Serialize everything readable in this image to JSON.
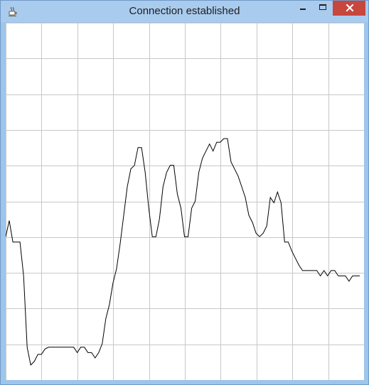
{
  "window": {
    "title": "Connection established",
    "icon": "java-cup-icon",
    "controls": {
      "minimize_icon": "minimize-icon",
      "maximize_icon": "maximize-icon",
      "close_icon": "close-icon"
    },
    "colors": {
      "frame": "#a9cbee",
      "close_button": "#c7463e",
      "plot_background": "#ffffff",
      "grid": "#c8c8c8",
      "line": "#000000"
    }
  },
  "chart_data": {
    "type": "line",
    "title": "",
    "xlabel": "",
    "ylabel": "",
    "grid": true,
    "xlim": [
      0,
      100
    ],
    "ylim": [
      0,
      100
    ],
    "series": [
      {
        "x": [
          0,
          1,
          2,
          3,
          4,
          5,
          6,
          7,
          8,
          9,
          10,
          11,
          12,
          14,
          16,
          18,
          19,
          20,
          21,
          22,
          23,
          24,
          25,
          26,
          27,
          28,
          29,
          30,
          31,
          32,
          33,
          34,
          35,
          36,
          37,
          38,
          39,
          40,
          41,
          42,
          43,
          44,
          45,
          46,
          47,
          48,
          49,
          50,
          51,
          52,
          53,
          54,
          55,
          56,
          57,
          58,
          59,
          60,
          61,
          62,
          63,
          64,
          65,
          66,
          67,
          68,
          69,
          70,
          71,
          72,
          73,
          74,
          75,
          76,
          77,
          78,
          79,
          80,
          81,
          82,
          83,
          84,
          85,
          86,
          87,
          88,
          89,
          90,
          91,
          92,
          93,
          94,
          95,
          96,
          97,
          98,
          99
        ],
        "y": [
          40,
          44.5,
          38.5,
          38.5,
          38.5,
          29,
          9,
          4,
          5,
          7,
          7,
          8.5,
          9,
          9,
          9,
          9,
          9,
          7.5,
          9,
          9,
          7.5,
          7.5,
          6,
          7.5,
          10,
          17,
          21,
          27,
          31,
          38,
          46,
          54,
          59,
          60,
          65,
          65,
          58,
          48,
          40,
          40,
          45,
          54,
          58,
          60,
          60,
          52,
          48,
          40,
          40,
          48,
          50,
          58,
          62,
          64,
          66,
          64,
          66.5,
          66.5,
          67.5,
          67.5,
          61,
          59,
          57,
          54,
          51,
          46,
          44,
          41,
          40,
          41,
          43,
          51,
          49.5,
          52.5,
          49.5,
          38.5,
          38.5,
          36,
          34,
          32,
          30.5,
          30.5,
          30.5,
          30.5,
          30.5,
          29,
          30.5,
          29,
          30.5,
          30.5,
          29,
          29,
          29,
          27.5,
          29,
          29,
          29
        ]
      }
    ]
  }
}
